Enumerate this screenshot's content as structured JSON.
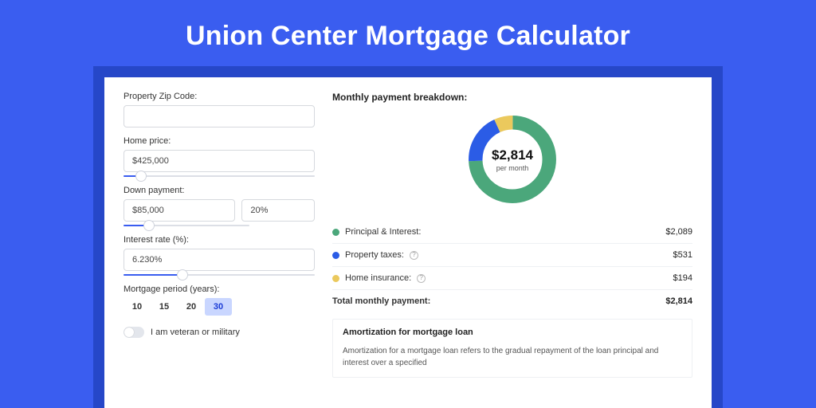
{
  "title": "Union Center Mortgage Calculator",
  "form": {
    "zip_label": "Property Zip Code:",
    "zip_value": "",
    "home_price_label": "Home price:",
    "home_price_value": "$425,000",
    "home_price_slider_pct": 9,
    "down_payment_label": "Down payment:",
    "down_payment_value": "$85,000",
    "down_payment_pct": "20%",
    "down_payment_slider_pct": 20,
    "interest_label": "Interest rate (%):",
    "interest_value": "6.230%",
    "interest_slider_pct": 31,
    "period_label": "Mortgage period (years):",
    "periods": [
      "10",
      "15",
      "20",
      "30"
    ],
    "period_active": "30",
    "veteran_label": "I am veteran or military"
  },
  "breakdown": {
    "title": "Monthly payment breakdown:",
    "total": "$2,814",
    "sub": "per month",
    "rows": [
      {
        "label": "Principal & Interest:",
        "value": "$2,089",
        "color": "#4ba77b",
        "info": false
      },
      {
        "label": "Property taxes:",
        "value": "$531",
        "color": "#2b5ce6",
        "info": true
      },
      {
        "label": "Home insurance:",
        "value": "$194",
        "color": "#ebc95d",
        "info": true
      }
    ],
    "total_label": "Total monthly payment:",
    "total_value": "$2,814"
  },
  "amort": {
    "title": "Amortization for mortgage loan",
    "body": "Amortization for a mortgage loan refers to the gradual repayment of the loan principal and interest over a specified"
  },
  "colors": {
    "green": "#4ba77b",
    "blue": "#2b5ce6",
    "yellow": "#ebc95d"
  },
  "chart_data": {
    "type": "pie",
    "title": "Monthly payment breakdown",
    "categories": [
      "Principal & Interest",
      "Property taxes",
      "Home insurance"
    ],
    "values": [
      2089,
      531,
      194
    ],
    "colors": [
      "#4ba77b",
      "#2b5ce6",
      "#ebc95d"
    ],
    "total": 2814,
    "center_label": "$2,814",
    "center_sub": "per month"
  }
}
